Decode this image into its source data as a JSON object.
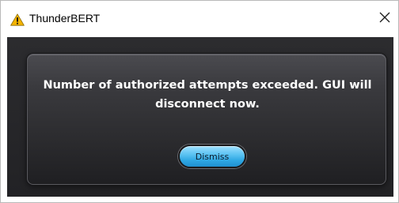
{
  "window": {
    "title": "ThunderBERT"
  },
  "dialog": {
    "message": "Number of authorized attempts exceeded. GUI will disconnect now.",
    "dismiss_label": "Dismiss"
  },
  "icons": {
    "title_icon": "warning-icon",
    "close_icon": "close-icon"
  },
  "colors": {
    "warning_fill": "#f5b400",
    "button_blue": "#2ea7e3",
    "panel_dark": "#2a2a2d"
  }
}
